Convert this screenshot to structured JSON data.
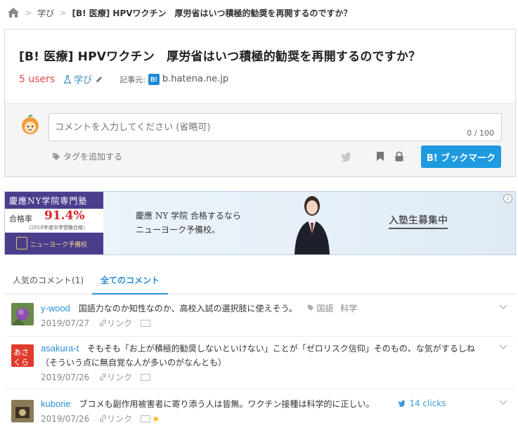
{
  "breadcrumb": {
    "category": "学び",
    "current": "[B! 医療] HPVワクチン　厚労省はいつ積極的勧奨を再開するのですか？"
  },
  "entry": {
    "title": "[B! 医療] HPVワクチン　厚労省はいつ積極的勧奨を再開するのですか？",
    "users": "5 users",
    "category": "学び",
    "source_label": "記事元:",
    "source_badge": "B!",
    "source_domain": "b.hatena.ne.jp"
  },
  "composer": {
    "placeholder": "コメントを入力してください (省略可)",
    "count": "0 / 100",
    "add_tag": "タグを追加する",
    "bookmark_button": "B! ブックマーク"
  },
  "ad": {
    "school": "慶應NY学院専門塾",
    "rate_label": "合格率",
    "rate_value": "91.4%",
    "rate_note": "（2018年度中学受験合格）",
    "yobi": "ニューヨーク予備校",
    "line1": "慶應 NY 学院 合格するなら",
    "line2": "ニューヨーク予備校。",
    "cta": "入塾生募集中",
    "info": "i"
  },
  "tabs": [
    {
      "label": "人気のコメント(1)"
    },
    {
      "label": "全てのコメント"
    }
  ],
  "comments": [
    {
      "user": "y-wood",
      "text": "国語力なのか知性なのか、高校入試の選択肢に使えそう。",
      "tags": [
        "国語",
        "科学"
      ],
      "date": "2019/07/27",
      "link": "リンク"
    },
    {
      "user": "asakura-t",
      "text": "そもそも「お上が積極的勧奨しないといけない」ことが「ゼロリスク信仰」そのもの、な気がするしね（そういう点に無自覚な人が多いのがなんとも）",
      "date": "2019/07/26",
      "link": "リンク"
    },
    {
      "user": "kuborie",
      "text": "ブコメも副作用被害者に寄り添う人は皆無。ワクチン接種は科学的に正しい。",
      "clicks": "14 clicks",
      "date": "2019/07/26",
      "link": "リンク",
      "star": "★"
    }
  ],
  "colors": {
    "accent": "#1e9be0",
    "users_red": "#e24b4b",
    "link_blue": "#2a8fd6",
    "ad_purple": "#4a3d8c"
  }
}
